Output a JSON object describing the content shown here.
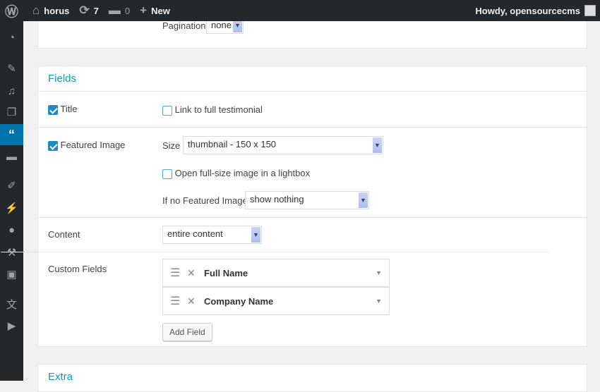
{
  "adminbar": {
    "site": "horus",
    "updates": "7",
    "comments": "0",
    "new": "New",
    "howdy": "Howdy, opensourcecms"
  },
  "sidebar": {
    "items": [
      "dashboard",
      "posts",
      "media",
      "pages",
      "testimonials",
      "comments",
      "appearance",
      "plugins",
      "users",
      "tools",
      "settings",
      "translate",
      "video"
    ],
    "active": "testimonials"
  },
  "top": {
    "pagination_label": "Pagination",
    "pagination_value": "none"
  },
  "fields": {
    "title": "Fields",
    "title_row": {
      "label": "Title",
      "checked": true,
      "link_label": "Link to full testimonial",
      "link_checked": false
    },
    "image_row": {
      "label": "Featured Image",
      "checked": true,
      "size_label": "Size",
      "size_value": "thumbnail - 150 x 150",
      "lightbox_label": "Open full-size image in a lightbox",
      "lightbox_checked": false,
      "noimage_label": "If no Featured Image",
      "noimage_value": "show nothing"
    },
    "content_row": {
      "label": "Content",
      "value": "entire content"
    },
    "custom_row": {
      "label": "Custom Fields",
      "items": [
        "Full Name",
        "Company Name"
      ],
      "add_label": "Add Field"
    }
  },
  "extra": {
    "title": "Extra"
  }
}
